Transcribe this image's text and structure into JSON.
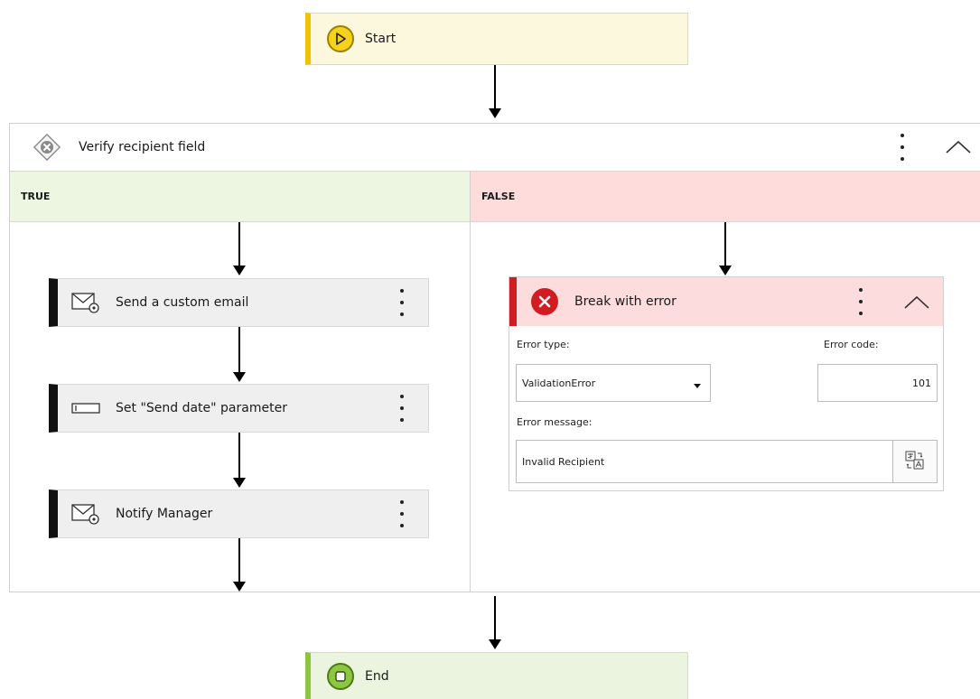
{
  "start": {
    "label": "Start"
  },
  "condition": {
    "title": "Verify recipient field",
    "true_label": "TRUE",
    "false_label": "FALSE"
  },
  "true_branch": {
    "actions": [
      {
        "label": "Send a custom email",
        "icon": "email-settings-icon"
      },
      {
        "label": "Set \"Send date\" parameter",
        "icon": "parameter-icon"
      },
      {
        "label": "Notify Manager",
        "icon": "email-settings-icon"
      }
    ]
  },
  "false_branch": {
    "break": {
      "title": "Break with error",
      "error_type_label": "Error type:",
      "error_type_value": "ValidationError",
      "error_code_label": "Error code:",
      "error_code_value": "101",
      "error_message_label": "Error message:",
      "error_message_value": "Invalid Recipient"
    }
  },
  "end": {
    "label": "End"
  },
  "colors": {
    "start_accent": "#f2c200",
    "end_accent": "#8cc63f",
    "true_bg": "#ecf6e1",
    "false_bg": "#ffdcdc",
    "error_accent": "#d11d22"
  }
}
